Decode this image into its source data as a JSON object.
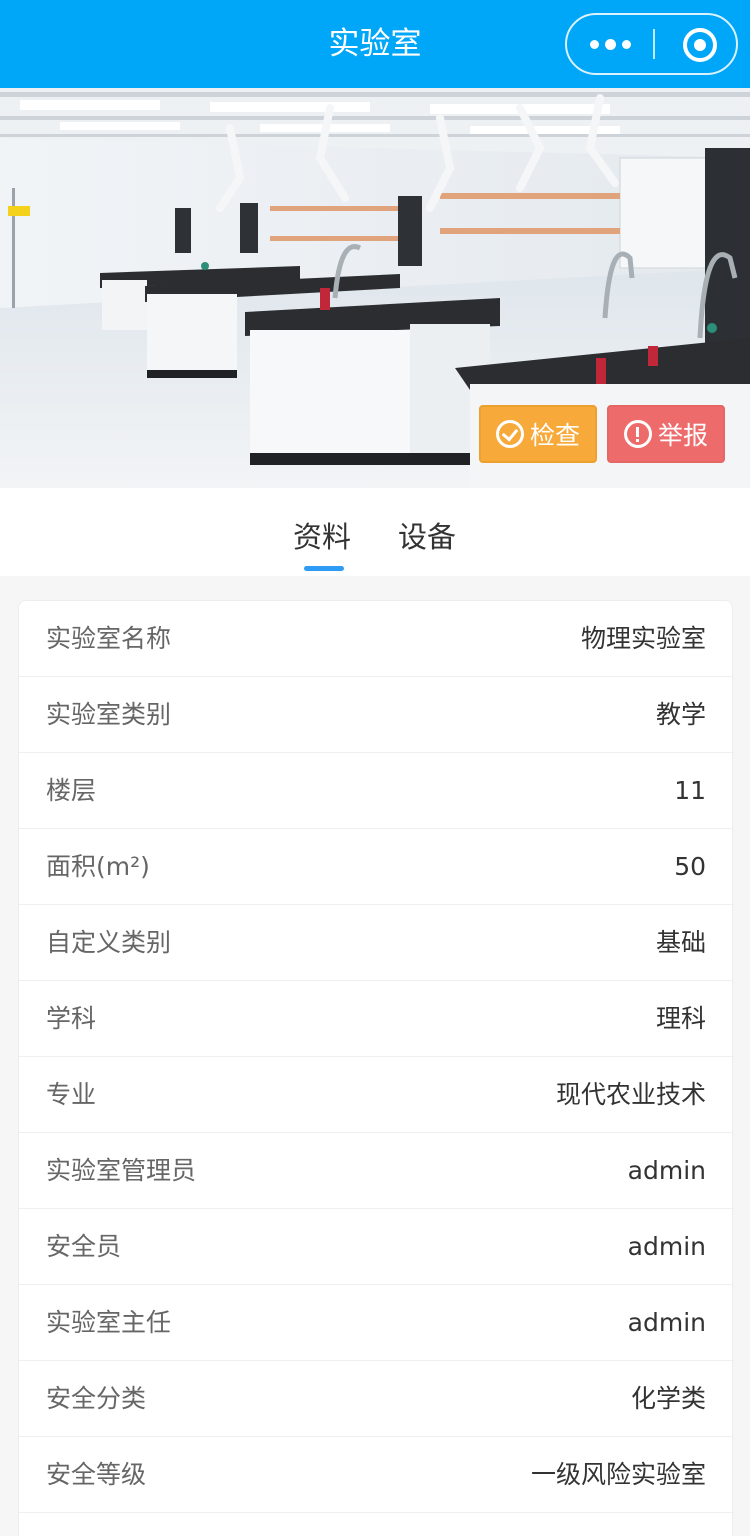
{
  "navbar": {
    "title": "实验室",
    "more_icon": "more-dots-icon",
    "close_icon": "target-circle-icon"
  },
  "hero": {
    "check_label": "检查",
    "report_label": "举报",
    "check_color": "#f7a93a",
    "report_color": "#ee6b6b"
  },
  "tabs": [
    {
      "label": "资料",
      "active": true
    },
    {
      "label": "设备",
      "active": false
    }
  ],
  "accent_color": "#2e9bf5",
  "info": [
    {
      "label": "实验室名称",
      "value": "物理实验室"
    },
    {
      "label": "实验室类别",
      "value": "教学"
    },
    {
      "label": "楼层",
      "value": "11"
    },
    {
      "label": "面积(m²)",
      "value": "50"
    },
    {
      "label": "自定义类别",
      "value": "基础"
    },
    {
      "label": "学科",
      "value": "理科"
    },
    {
      "label": "专业",
      "value": "现代农业技术"
    },
    {
      "label": "实验室管理员",
      "value": "admin"
    },
    {
      "label": "安全员",
      "value": "admin"
    },
    {
      "label": "实验室主任",
      "value": "admin"
    },
    {
      "label": "安全分类",
      "value": "化学类"
    },
    {
      "label": "安全等级",
      "value": "一级风险实验室"
    }
  ]
}
